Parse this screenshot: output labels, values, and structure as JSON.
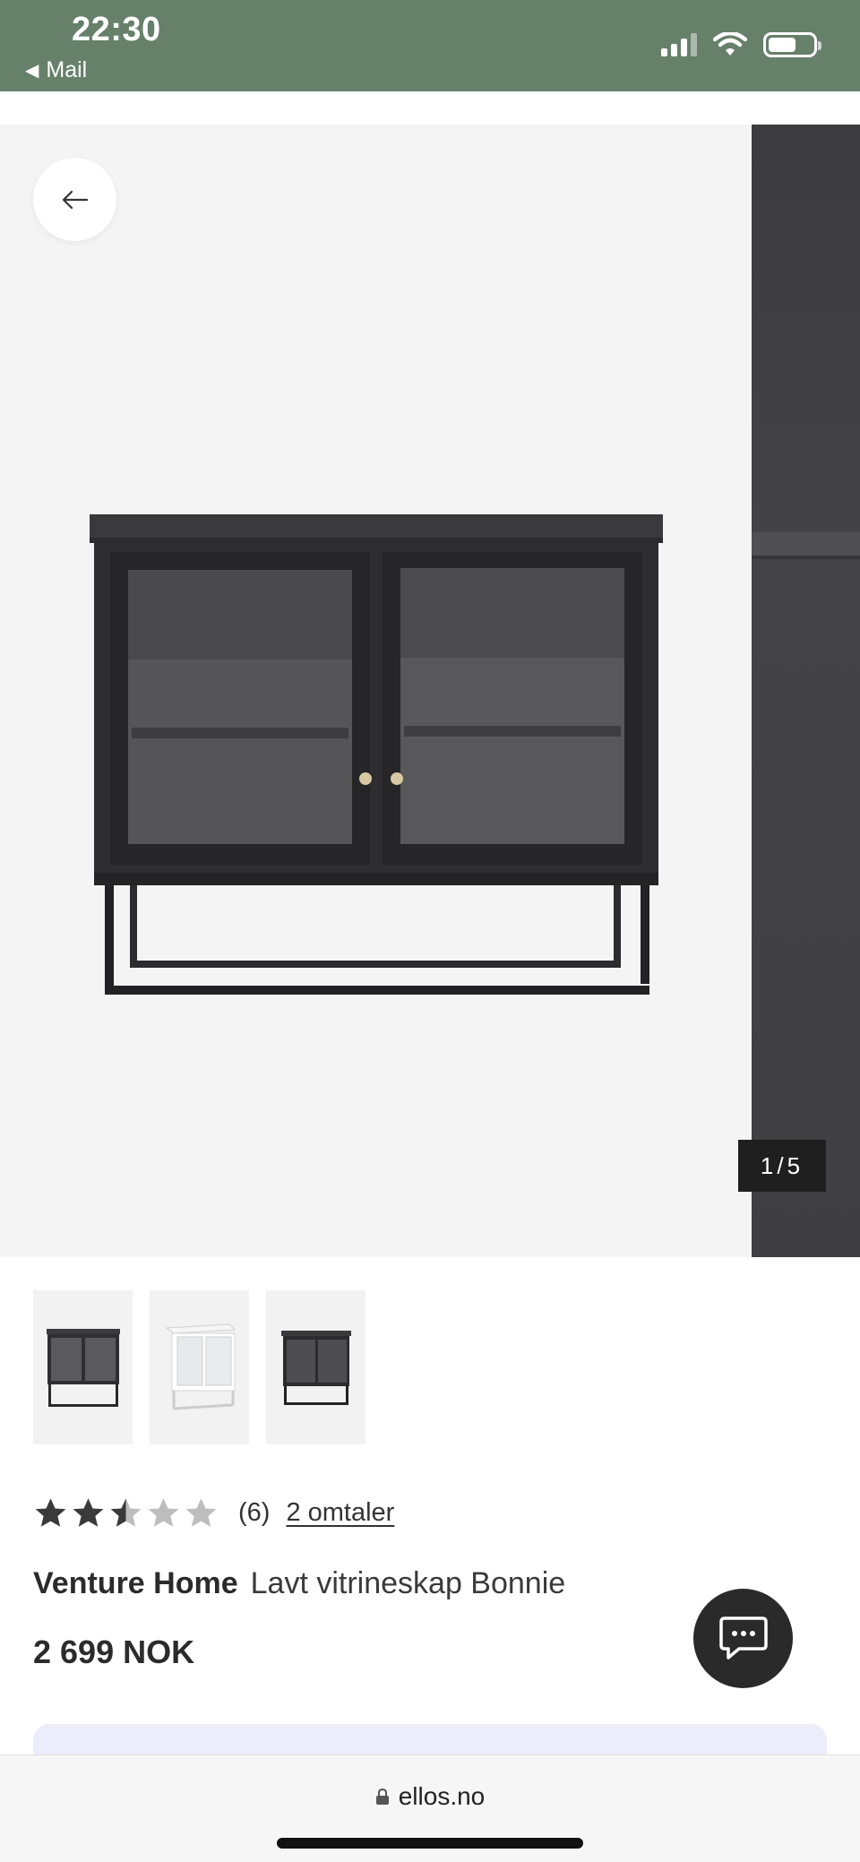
{
  "status_bar": {
    "time": "22:30",
    "back_app": "Mail",
    "color": "#66806a"
  },
  "carousel": {
    "counter_current": "1",
    "counter_separator": "/",
    "counter_total": "5",
    "icons": {
      "back": "arrow-left-icon"
    }
  },
  "thumbnails": [
    {
      "variant": "black cabinet front"
    },
    {
      "variant": "white cabinet angle"
    },
    {
      "variant": "black cabinet angle"
    }
  ],
  "rating": {
    "value": 2.5,
    "max": 5,
    "count": "(6)",
    "reviews_link": "2 omtaler"
  },
  "product": {
    "brand": "Venture Home",
    "name": "Lavt vitrineskap Bonnie",
    "price": "2 699 NOK"
  },
  "browser": {
    "url": "ellos.no",
    "icons": {
      "lock": "lock-icon"
    }
  },
  "chat": {
    "icon": "chat-bubble-icon"
  }
}
